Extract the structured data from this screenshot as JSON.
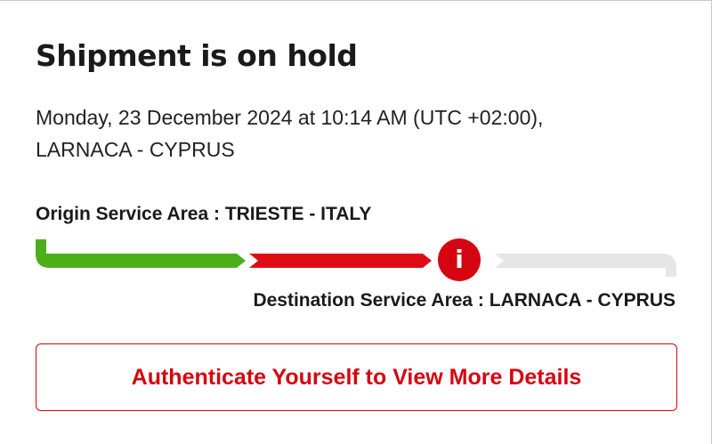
{
  "status": {
    "title": "Shipment is on hold",
    "datetime": "Monday, 23 December 2024 at 10:14 AM (UTC +02:00),",
    "location": "LARNACA - CYPRUS"
  },
  "route": {
    "origin_label": "Origin Service Area : ",
    "origin_value": "TRIESTE - ITALY",
    "destination_label": "Destination Service Area : ",
    "destination_value": "LARNACA - CYPRUS",
    "alert_symbol": "i",
    "alert_icon": "info-alert-icon",
    "segments": [
      {
        "name": "picked-up",
        "state": "complete",
        "color": "#4caf1a"
      },
      {
        "name": "in-transit",
        "state": "on-hold",
        "color": "#e00c14"
      },
      {
        "name": "delivery",
        "state": "pending",
        "color": "#e6e6e6"
      }
    ]
  },
  "actions": {
    "authenticate_label": "Authenticate Yourself to View More Details"
  },
  "colors": {
    "brand_red": "#d40511",
    "progress_green": "#4caf1a",
    "progress_red": "#e00c14",
    "progress_grey": "#e6e6e6",
    "text": "#1a1a1a"
  }
}
